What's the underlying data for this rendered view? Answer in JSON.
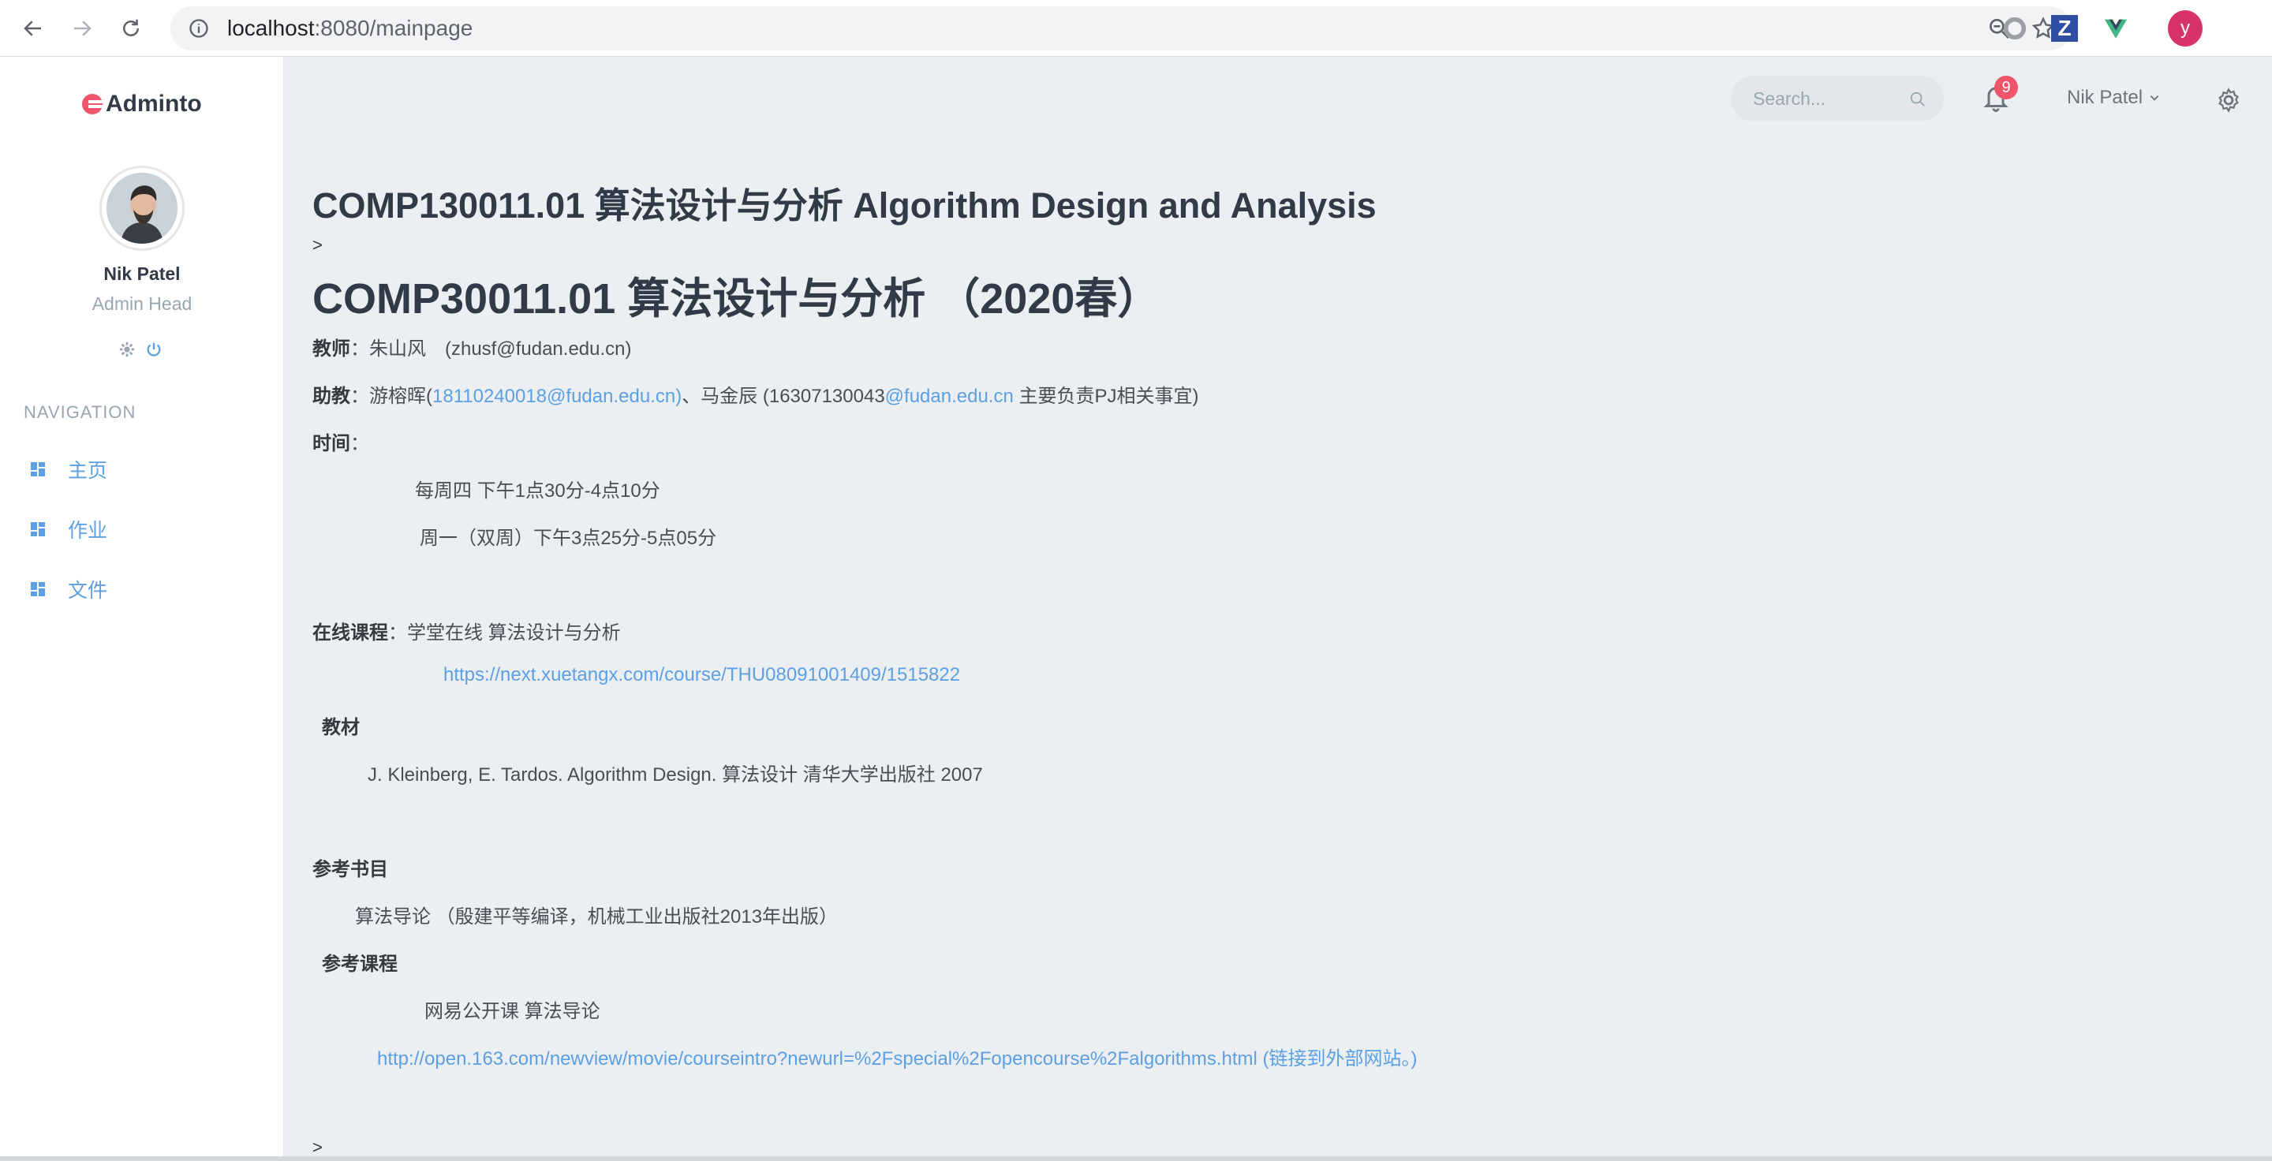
{
  "browser": {
    "url_host": "localhost",
    "url_rest": ":8080/mainpage",
    "profile_initial": "y"
  },
  "sidebar": {
    "logo": "Adminto",
    "user_name": "Nik Patel",
    "user_role": "Admin Head",
    "nav_title": "NAVIGATION",
    "items": [
      {
        "label": "主页"
      },
      {
        "label": "作业"
      },
      {
        "label": "文件"
      }
    ]
  },
  "topbar": {
    "search_placeholder": "Search...",
    "notification_count": "9",
    "user_name": "Nik Patel"
  },
  "content": {
    "course_title": "COMP130011.01 算法设计与分析 Algorithm Design and Analysis",
    "crumb_gt_1": ">",
    "term_title": "COMP30011.01 算法设计与分析 （2020春）",
    "teacher_label": "教师",
    "teacher_value": "：朱山风　(zhusf@fudan.edu.cn)",
    "ta_label": "助教",
    "ta_prefix": "：游榕晖(",
    "ta_link1": "18110240018@fudan.edu.cn)",
    "ta_mid": "、马金辰 (16307130043",
    "ta_link2": "@fudan.edu.cn",
    "ta_suffix": " 主要负责PJ相关事宜)",
    "time_label": "时间",
    "time_colon": "：",
    "time_1": "每周四 下午1点30分-4点10分",
    "time_2": "周一（双周）下午3点25分-5点05分",
    "online_label": "在线课程",
    "online_value": "：学堂在线  算法设计与分析",
    "online_link": "https://next.xuetangx.com/course/THU08091001409/1515822",
    "textbook_label": "教材",
    "textbook_value": "J. Kleinberg, E. Tardos. Algorithm Design.   算法设计 清华大学出版社 2007",
    "refbook_label": "参考书目",
    "refbook_value": "算法导论 （殷建平等编译，机械工业出版社2013年出版）",
    "refcourse_label": "参考课程",
    "refcourse_value": "网易公开课    算法导论",
    "refcourse_link": "http://open.163.com/newview/movie/courseintro?newurl=%2Fspecial%2Fopencourse%2Falgorithms.html (链接到外部网站。)",
    "crumb_gt_2": ">"
  }
}
